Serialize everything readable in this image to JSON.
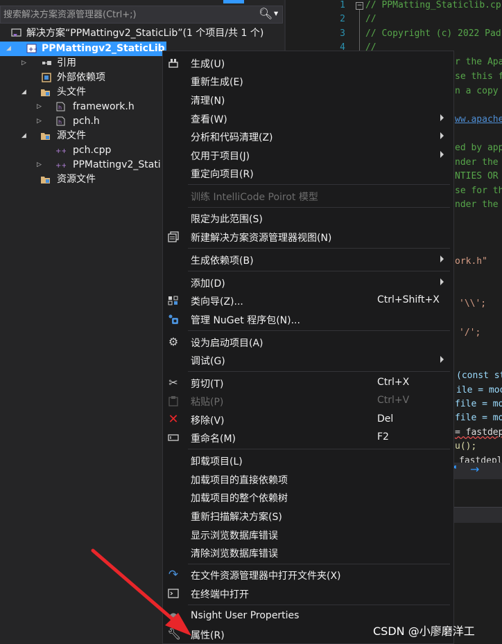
{
  "search": {
    "placeholder": "搜索解决方案资源管理器(Ctrl+;)"
  },
  "tree": {
    "solution_label": "解决方案“PPMattingv2_StaticLib”(1 个项目/共 1 个)",
    "project_label": "PPMattingv2_StaticLib",
    "references_label": "引用",
    "external_deps_label": "外部依赖项",
    "headers_label": "头文件",
    "header_file_1": "framework.h",
    "header_file_2": "pch.h",
    "sources_label": "源文件",
    "source_file_1": "pch.cpp",
    "source_file_2": "PPMattingv2_Stati",
    "resources_label": "资源文件"
  },
  "editor": {
    "line_numbers": [
      "1",
      "2",
      "3",
      "4"
    ],
    "line1": "// PPMatting_Staticlib.cp",
    "line2": "//",
    "line3": "// Copyright (c) 2022 Pad",
    "line4": "//",
    "frag_1": "r the Apa",
    "frag_2": "se this f",
    "frag_3": "n a copy",
    "frag_4": "ww.apache.",
    "frag_5": "ed by app",
    "frag_6": "nder the",
    "frag_7": "NTIES OR",
    "frag_8": "se for th",
    "frag_9": "nder the",
    "frag_10": "ork.h\"",
    "frag_11": "'\\\\';",
    "frag_12": "'/';",
    "frag_13": "(const st",
    "frag_14": "ile = moo",
    "frag_15": "file = mo",
    "frag_16": "file = mo",
    "frag_17": "= fastdep",
    "frag_18": "u();",
    "frag_19": "fastdepl",
    "nav_arrow": "→"
  },
  "menu": {
    "build": "生成(U)",
    "rebuild": "重新生成(E)",
    "clean": "清理(N)",
    "view": "查看(W)",
    "analyze": "分析和代码清理(Z)",
    "project_only": "仅用于项目(J)",
    "retarget": "重定向项目(R)",
    "intellicode": "训练 IntelliCode Poirot 模型",
    "scope_to_this": "限定为此范围(S)",
    "new_explorer_view": "新建解决方案资源管理器视图(N)",
    "build_dependencies": "生成依赖项(B)",
    "add": "添加(D)",
    "class_wizard": "类向导(Z)...",
    "class_wizard_shortcut": "Ctrl+Shift+X",
    "manage_nuget": "管理 NuGet 程序包(N)...",
    "set_startup": "设为启动项目(A)",
    "debug": "调试(G)",
    "cut": "剪切(T)",
    "cut_shortcut": "Ctrl+X",
    "paste": "粘贴(P)",
    "paste_shortcut": "Ctrl+V",
    "remove": "移除(V)",
    "remove_shortcut": "Del",
    "rename": "重命名(M)",
    "rename_shortcut": "F2",
    "unload": "卸载项目(L)",
    "load_direct_deps": "加载项目的直接依赖项",
    "load_dep_tree": "加载项目的整个依赖树",
    "rescan": "重新扫描解决方案(S)",
    "show_browse_errors": "显示浏览数据库错误",
    "clear_browse_errors": "清除浏览数据库错误",
    "open_in_explorer": "在文件资源管理器中打开文件夹(X)",
    "open_in_terminal": "在终端中打开",
    "nsight_properties": "Nsight User Properties",
    "properties": "属性(R)"
  },
  "watermark": "CSDN @小廖磨洋工",
  "colors": {
    "selection": "#3399ff",
    "arrow_red": "#e8262a",
    "comment_green": "#57a64a",
    "line_number": "#2b91af"
  }
}
